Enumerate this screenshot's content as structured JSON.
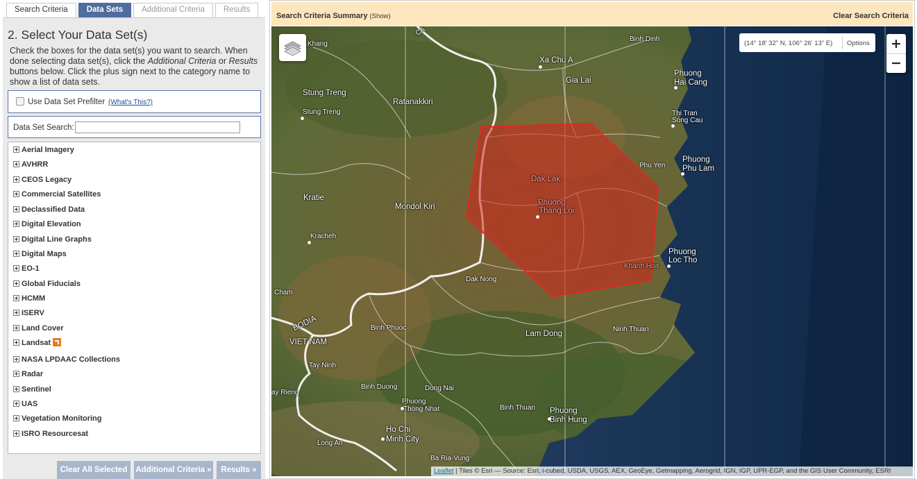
{
  "tabs": [
    {
      "label": "Search Criteria"
    },
    {
      "label": "Data Sets"
    },
    {
      "label": "Additional Criteria"
    },
    {
      "label": "Results"
    }
  ],
  "step": {
    "title": "2. Select Your Data Set(s)",
    "instructions": {
      "part1": "Check the boxes for the data set(s) you want to search. When done selecting data set(s), click the ",
      "em1": "Additional Criteria",
      "part2": " or ",
      "em2": "Results",
      "part3": " buttons below. Click the plus sign next to the category name to show a list of data sets."
    }
  },
  "prefilter": {
    "label": "Use Data Set Prefilter",
    "help": "(What's This?)"
  },
  "search": {
    "label": "Data Set Search:",
    "value": ""
  },
  "categories": [
    "Aerial Imagery",
    "AVHRR",
    "CEOS Legacy",
    "Commercial Satellites",
    "Declassified Data",
    "Digital Elevation",
    "Digital Line Graphs",
    "Digital Maps",
    "EO-1",
    "Global Fiducials",
    "HCMM",
    "ISERV",
    "Land Cover",
    "Landsat",
    "NASA LPDAAC Collections",
    "Radar",
    "Sentinel",
    "UAS",
    "Vegetation Monitoring",
    "ISRO Resourcesat"
  ],
  "buttons": {
    "clear": "Clear All Selected",
    "additional": "Additional Criteria »",
    "results": "Results »"
  },
  "summary": {
    "title": "Search Criteria Summary",
    "show": "(Show)",
    "clear": "Clear Search Criteria"
  },
  "map": {
    "coords": "(14° 18' 32\" N, 106° 26' 13\" E)",
    "options": "Options",
    "zoom_in": "+",
    "zoom_out": "−",
    "attribution_link": "Leaflet",
    "attribution_text": " | Tiles © Esri — Source: Esri, i-cubed, USDA, USGS, AEX, GeoEye, Getmapping, Aerogrid, IGN, IGP, UPR-EGP, and the GIS User Community, ESRI",
    "places": {
      "khang": "Khang",
      "binh_dinh": "Binh Dinh",
      "xa_chu_a": "Xa Chu A",
      "gia_lai": "Gia Lai",
      "phuong_hai_cang_1": "Phuong",
      "phuong_hai_cang_2": "Hai Cang",
      "stung_treng_big": "Stung Treng",
      "stung_treng_small": "Stung Treng",
      "ratanakkiri": "Ratanakkiri",
      "thi_tran_1": "Thi Tran",
      "thi_tran_2": "Song Cau",
      "phu_yen": "Phu Yen",
      "phu_lam_1": "Phuong",
      "phu_lam_2": "Phu Lam",
      "dak_lak": "Dak Lak",
      "thang_loi_1": "Phuong",
      "thang_loi_2": "Thang Loi",
      "kratie": "Kratie",
      "mondol_kiri": "Mondol Kiri",
      "kracheh": "Kracheh",
      "loc_tho_1": "Phuong",
      "loc_tho_2": "Loc Tho",
      "khanh_hoa": "Khanh Hoa",
      "dak_nong": "Dak Nong",
      "cham": "Cham",
      "ninh_thuan": "Ninh Thuan",
      "binh_phuoc": "Binh Phuoc",
      "lam_dong": "Lam Dong",
      "cambodia": "BODIA",
      "viet_nam": "VIET NAM",
      "tay_ninh": "Tay Ninh",
      "binh_duong": "Binh Duong",
      "dong_nai": "Dong Nai",
      "vay_rieng": "ay Rieng",
      "thong_nhat_1": "Phuong",
      "thong_nhat_2": "Thong Nhat",
      "binh_thuan": "Binh Thuan",
      "binh_hung_1": "Phuong",
      "binh_hung_2": "Binh Hung",
      "ho_chi_minh_1": "Ho Chi",
      "ho_chi_minh_2": "Minh City",
      "long_an": "Long An",
      "ba_ria": "Ba Ria-Vung",
      "ca_label": "CA"
    }
  }
}
